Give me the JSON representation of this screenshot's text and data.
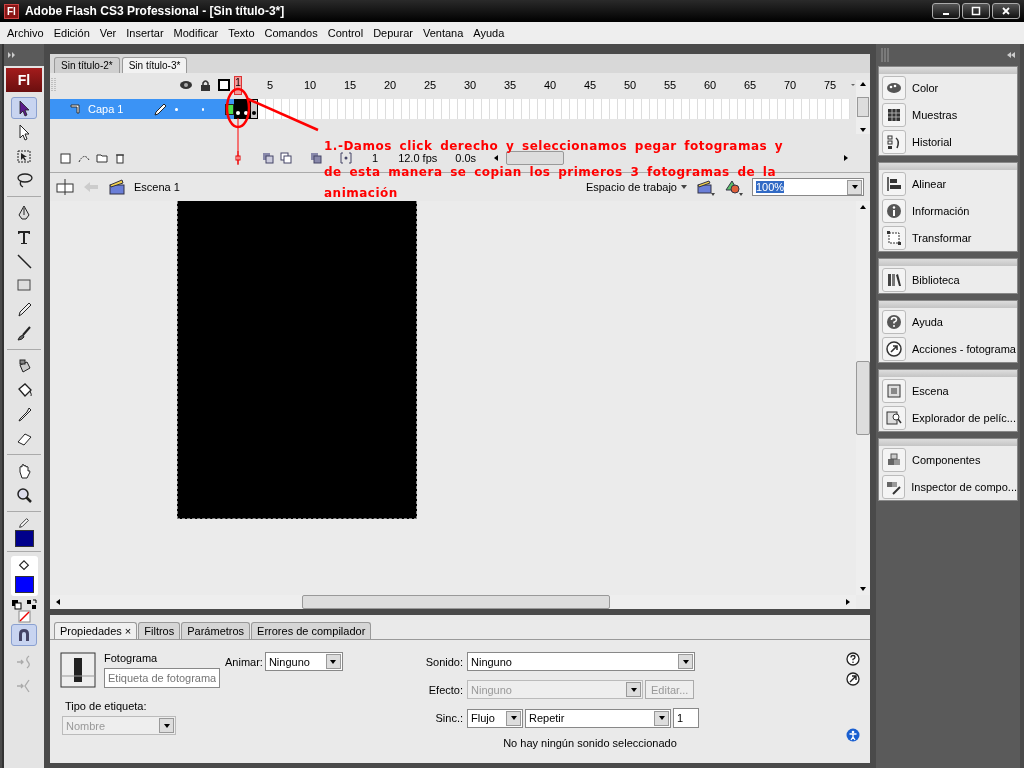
{
  "window": {
    "logo": "Fl",
    "title": "Adobe Flash CS3 Professional - [Sin título-3*]"
  },
  "menu": [
    "Archivo",
    "Edición",
    "Ver",
    "Insertar",
    "Modificar",
    "Texto",
    "Comandos",
    "Control",
    "Depurar",
    "Ventana",
    "Ayuda"
  ],
  "toolbar": {
    "logo": "Fl",
    "tools": [
      {
        "selected": true
      },
      {
        "selected": false
      },
      {
        "selected": false
      },
      {
        "selected": false
      },
      {
        "selected": false
      },
      {
        "selected": false
      },
      {
        "selected": false
      },
      {
        "selected": false
      },
      {
        "selected": false
      },
      {
        "selected": false
      },
      {
        "selected": false
      },
      {
        "selected": false
      },
      {
        "selected": false
      },
      {
        "selected": false
      },
      {
        "selected": false
      },
      {
        "selected": false
      }
    ],
    "stroke_color": {
      "color": "#00008b"
    },
    "fill_color": {
      "color": "#0000ff"
    },
    "snap": {
      "on": true
    }
  },
  "documents": [
    {
      "label": "Sin título-2*",
      "selected": false
    },
    {
      "label": "Sin título-3*",
      "selected": true
    }
  ],
  "timeline": {
    "ruler": [
      "1",
      "5",
      "10",
      "15",
      "20",
      "25",
      "30",
      "35",
      "40",
      "45",
      "50",
      "55",
      "60",
      "65",
      "70",
      "75"
    ],
    "layers": [
      {
        "name": "Capa 1",
        "selected": true
      }
    ],
    "frames": [
      {
        "selected": true
      },
      {
        "selected": true
      },
      {
        "selected": false
      }
    ],
    "current_frame": "1",
    "frame_rate": "12.0 fps",
    "elapsed": "0.0s"
  },
  "edit_bar": {
    "scene": "Escena 1",
    "workspace": "Espacio de trabajo",
    "zoom": "100%"
  },
  "panels": [
    [
      "Color",
      "Muestras",
      "Historial"
    ],
    [
      "Alinear",
      "Información",
      "Transformar"
    ],
    [
      "Biblioteca"
    ],
    [
      "Ayuda",
      "Acciones - fotograma"
    ],
    [
      "Escena",
      "Explorador de pelíc..."
    ],
    [
      "Componentes",
      "Inspector de compo..."
    ]
  ],
  "properties": {
    "tabs": [
      {
        "label": "Propiedades",
        "selected": true,
        "close": "×"
      },
      {
        "label": "Filtros",
        "selected": false
      },
      {
        "label": "Parámetros",
        "selected": false
      },
      {
        "label": "Errores de compilador",
        "selected": false
      }
    ],
    "frame_label": "Fotograma",
    "label_field": {
      "placeholder": "Etiqueta de fotograma"
    },
    "label_type": {
      "label": "Tipo de etiqueta:",
      "value": "Nombre",
      "disabled": true
    },
    "tween": {
      "label": "Animar:",
      "value": "Ninguno",
      "disabled": false
    },
    "sound": {
      "label": "Sonido:",
      "value": "Ninguno",
      "disabled": false
    },
    "effect": {
      "label": "Efecto:",
      "value": "Ninguno",
      "disabled": true
    },
    "edit_button": {
      "label": "Editar...",
      "disabled": true
    },
    "sync": {
      "label": "Sinc.:",
      "value": "Flujo",
      "disabled": false
    },
    "repeat": {
      "value": "Repetir",
      "disabled": false
    },
    "repeat_count": {
      "value": "1"
    },
    "status": "No hay ningún sonido seleccionado"
  },
  "annotation": {
    "lines": [
      "1.-Damos click derecho y seleccionamos pegar fotogramas y",
      "de esta manera se copian los primeros 3 fotogramas de la",
      "animación"
    ]
  }
}
